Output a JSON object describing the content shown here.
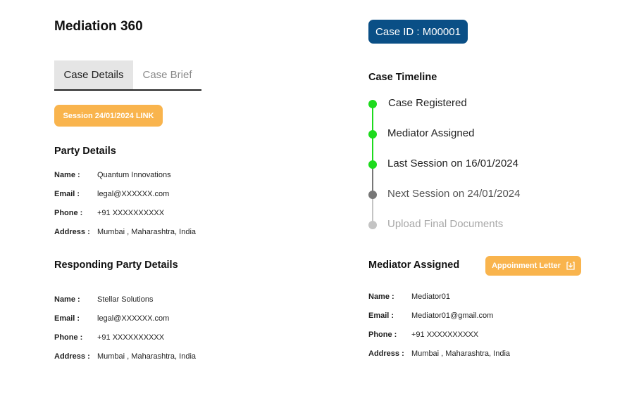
{
  "header": {
    "title": "Mediation 360"
  },
  "tabs": [
    {
      "label": "Case Details",
      "active": true
    },
    {
      "label": "Case Brief",
      "active": false
    }
  ],
  "session_link": {
    "label": "Session 24/01/2024 LINK"
  },
  "party": {
    "title": "Party Details",
    "fields": [
      {
        "label": "Name :",
        "value": "Quantum Innovations"
      },
      {
        "label": "Email :",
        "value": "legal@XXXXXX.com"
      },
      {
        "label": "Phone :",
        "value": "+91 XXXXXXXXXX"
      },
      {
        "label": "Address :",
        "value": "Mumbai , Maharashtra, India"
      }
    ]
  },
  "responding_party": {
    "title": "Responding Party Details",
    "fields": [
      {
        "label": "Name :",
        "value": "Stellar Solutions"
      },
      {
        "label": "Email :",
        "value": "legal@XXXXXX.com"
      },
      {
        "label": "Phone :",
        "value": "+91 XXXXXXXXXX"
      },
      {
        "label": "Address :",
        "value": "Mumbai , Maharashtra, India"
      }
    ]
  },
  "case_id": {
    "label": "Case ID : M00001"
  },
  "timeline": {
    "title": "Case Timeline",
    "steps": [
      {
        "label": "Case Registered",
        "status": "done"
      },
      {
        "label": "Mediator Assigned",
        "status": "done"
      },
      {
        "label": "Last Session on 16/01/2024",
        "status": "done"
      },
      {
        "label": "Next Session on 24/01/2024",
        "status": "upcoming"
      },
      {
        "label": "Upload Final Documents",
        "status": "pending"
      }
    ]
  },
  "mediator": {
    "title": "Mediator Assigned",
    "appointment_button": "Appoinment Letter",
    "fields": [
      {
        "label": "Name :",
        "value": "Mediator01"
      },
      {
        "label": "Email :",
        "value": "Mediator01@gmail.com"
      },
      {
        "label": "Phone :",
        "value": "+91 XXXXXXXXXX"
      },
      {
        "label": "Address :",
        "value": "Mumbai , Maharashtra, India"
      }
    ]
  },
  "colors": {
    "accent_orange": "#f9b44d",
    "case_id_blue": "#0a4f86",
    "timeline_done": "#1ddb1d",
    "timeline_upcoming": "#777777",
    "timeline_pending": "#c4c4c4"
  },
  "icons": {
    "download": "download-icon"
  }
}
